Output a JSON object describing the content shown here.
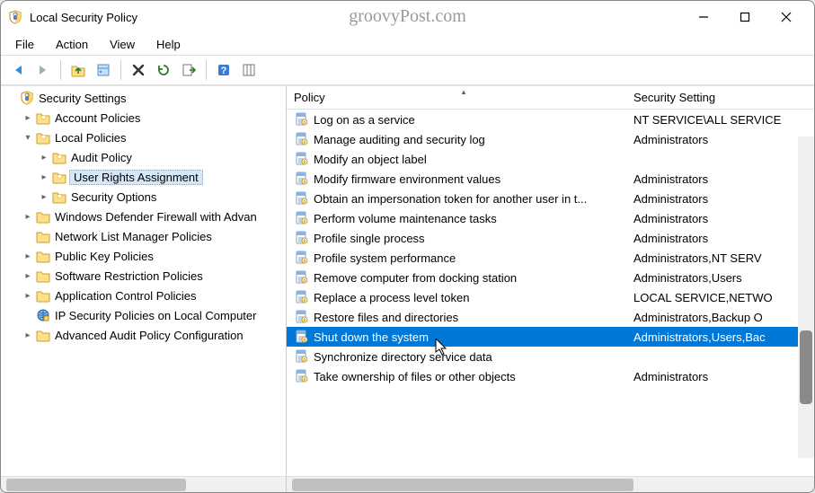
{
  "window": {
    "title": "Local Security Policy",
    "watermark": "groovyPost.com"
  },
  "menu": {
    "items": [
      "File",
      "Action",
      "View",
      "Help"
    ]
  },
  "columns": {
    "policy": "Policy",
    "setting": "Security Setting"
  },
  "tree": {
    "root": "Security Settings",
    "nodes": [
      {
        "label": "Account Policies",
        "level": 1,
        "expander": "▸",
        "icon": "folder-policy"
      },
      {
        "label": "Local Policies",
        "level": 1,
        "expander": "▾",
        "icon": "folder-policy"
      },
      {
        "label": "Audit Policy",
        "level": 2,
        "expander": "▸",
        "icon": "folder-policy"
      },
      {
        "label": "User Rights Assignment",
        "level": 2,
        "expander": "▸",
        "icon": "folder-policy",
        "selected": true
      },
      {
        "label": "Security Options",
        "level": 2,
        "expander": "▸",
        "icon": "folder-policy"
      },
      {
        "label": "Windows Defender Firewall with Advan",
        "level": 1,
        "expander": "▸",
        "icon": "folder"
      },
      {
        "label": "Network List Manager Policies",
        "level": 1,
        "expander": "",
        "icon": "folder"
      },
      {
        "label": "Public Key Policies",
        "level": 1,
        "expander": "▸",
        "icon": "folder"
      },
      {
        "label": "Software Restriction Policies",
        "level": 1,
        "expander": "▸",
        "icon": "folder"
      },
      {
        "label": "Application Control Policies",
        "level": 1,
        "expander": "▸",
        "icon": "folder"
      },
      {
        "label": "IP Security Policies on Local Computer",
        "level": 1,
        "expander": "",
        "icon": "ipsec"
      },
      {
        "label": "Advanced Audit Policy Configuration",
        "level": 1,
        "expander": "▸",
        "icon": "folder"
      }
    ]
  },
  "policies": [
    {
      "name": "Log on as a service",
      "setting": "NT SERVICE\\ALL SERVICE"
    },
    {
      "name": "Manage auditing and security log",
      "setting": "Administrators"
    },
    {
      "name": "Modify an object label",
      "setting": ""
    },
    {
      "name": "Modify firmware environment values",
      "setting": "Administrators"
    },
    {
      "name": "Obtain an impersonation token for another user in t...",
      "setting": "Administrators"
    },
    {
      "name": "Perform volume maintenance tasks",
      "setting": "Administrators"
    },
    {
      "name": "Profile single process",
      "setting": "Administrators"
    },
    {
      "name": "Profile system performance",
      "setting": "Administrators,NT SERV"
    },
    {
      "name": "Remove computer from docking station",
      "setting": "Administrators,Users"
    },
    {
      "name": "Replace a process level token",
      "setting": "LOCAL SERVICE,NETWO"
    },
    {
      "name": "Restore files and directories",
      "setting": "Administrators,Backup O"
    },
    {
      "name": "Shut down the system",
      "setting": "Administrators,Users,Bac",
      "selected": true
    },
    {
      "name": "Synchronize directory service data",
      "setting": ""
    },
    {
      "name": "Take ownership of files or other objects",
      "setting": "Administrators"
    }
  ]
}
